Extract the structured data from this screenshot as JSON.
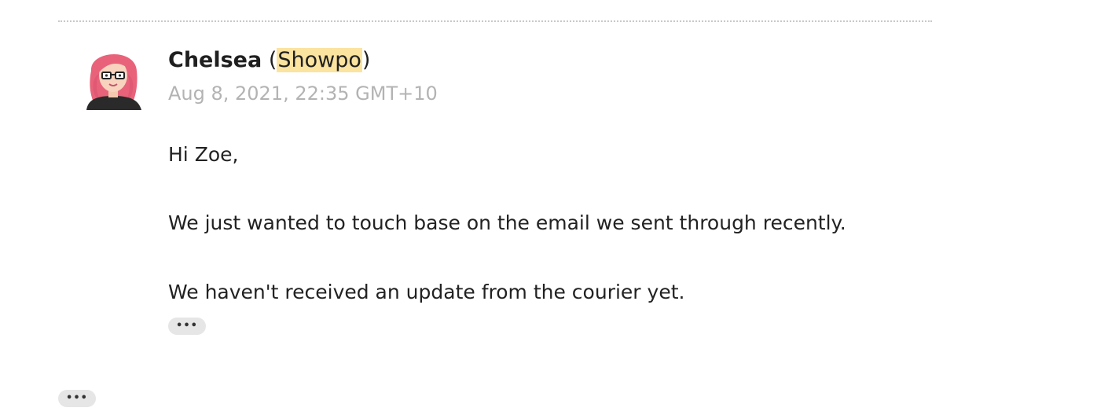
{
  "message": {
    "sender_name": "Chelsea",
    "open_paren": "(",
    "sender_org": "Showpo",
    "close_paren": ")",
    "timestamp": "Aug 8, 2021, 22:35 GMT+10",
    "avatar_icon": "female-user-avatar-icon",
    "body_lines": [
      "Hi Zoe,",
      "We just wanted to touch base on the email we sent through recently.",
      "We haven't received an update from the courier yet."
    ],
    "show_quoted_label": "•••"
  },
  "thread": {
    "show_more_label": "•••"
  },
  "colors": {
    "highlight": "#fbe3a0",
    "timestamp": "#b3b3b3",
    "button_bg": "#e6e6e6"
  }
}
